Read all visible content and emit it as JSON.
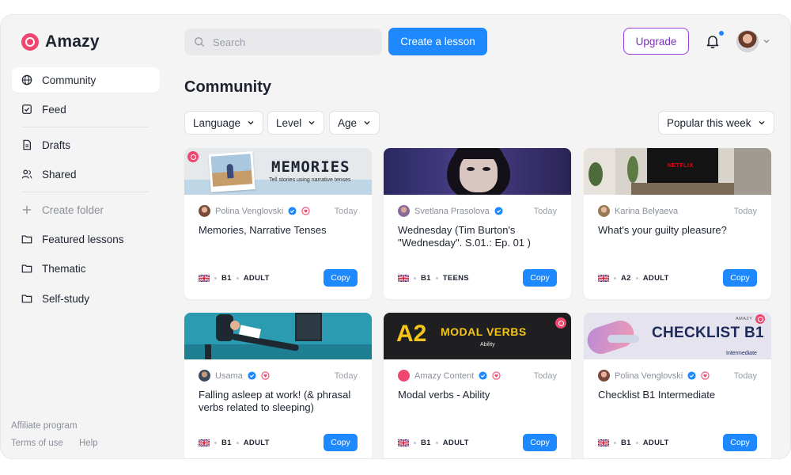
{
  "app": {
    "name": "Amazy"
  },
  "sidebar": {
    "items": [
      {
        "label": "Community",
        "icon": "globe-icon"
      },
      {
        "label": "Feed",
        "icon": "checkbox-icon"
      },
      {
        "label": "Drafts",
        "icon": "document-icon"
      },
      {
        "label": "Shared",
        "icon": "people-icon"
      },
      {
        "label": "Create folder",
        "icon": "plus-icon"
      },
      {
        "label": "Featured lessons",
        "icon": "folder-icon"
      },
      {
        "label": "Thematic",
        "icon": "folder-icon"
      },
      {
        "label": "Self-study",
        "icon": "folder-icon"
      }
    ],
    "footer": {
      "affiliate": "Affiliate program",
      "terms": "Terms of use",
      "help": "Help"
    }
  },
  "header": {
    "search_placeholder": "Search",
    "create_label": "Create a lesson",
    "upgrade_label": "Upgrade"
  },
  "main": {
    "title": "Community",
    "filters": {
      "language": "Language",
      "level": "Level",
      "age": "Age",
      "sort": "Popular this week"
    }
  },
  "cards": [
    {
      "author": "Polina Venglovski",
      "when": "Today",
      "title": "Memories, Narrative Tenses",
      "level": "B1",
      "audience": "ADULT",
      "copy": "Copy",
      "thumb_heading": "MEMORIES",
      "thumb_sub": "Tell stories using narrative tenses"
    },
    {
      "author": "Svetlana Prasolova",
      "when": "Today",
      "title": "Wednesday (Tim Burton's \"Wednesday\". S.01.: Ep. 01 )",
      "level": "B1",
      "audience": "TEENS",
      "copy": "Copy"
    },
    {
      "author": "Karina Belyaeva",
      "when": "Today",
      "title": "What's your guilty pleasure?",
      "level": "A2",
      "audience": "ADULT",
      "copy": "Copy",
      "thumb_tv": "NETFLIX"
    },
    {
      "author": "Usama",
      "when": "Today",
      "title": "Falling asleep at work! (& phrasal verbs related to sleeping)",
      "level": "B1",
      "audience": "ADULT",
      "copy": "Copy"
    },
    {
      "author": "Amazy Content",
      "when": "Today",
      "title": "Modal verbs - Ability",
      "level": "B1",
      "audience": "ADULT",
      "copy": "Copy",
      "thumb_level": "A2",
      "thumb_heading": "MODAL VERBS",
      "thumb_sub": "Ability"
    },
    {
      "author": "Polina Venglovski",
      "when": "Today",
      "title": "Checklist B1 Intermediate",
      "level": "B1",
      "audience": "ADULT",
      "copy": "Copy",
      "thumb_brand": "AMAZY",
      "thumb_heading": "CHECKLIST B1",
      "thumb_sub": "Intermediate"
    }
  ],
  "colors": {
    "accent": "#1e88ff",
    "brand": "#ef476f",
    "upgrade": "#9b3fd8"
  }
}
